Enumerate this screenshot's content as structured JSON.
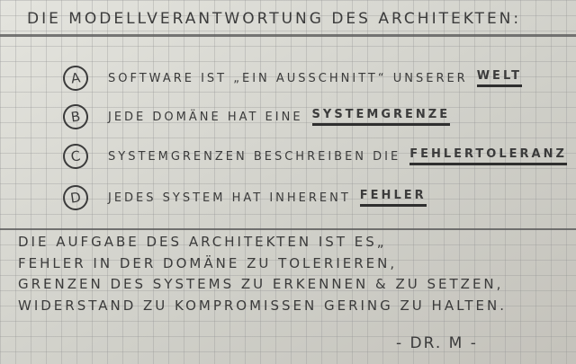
{
  "title": "Die Modellverantwortung des Architekten:",
  "items": [
    {
      "letter": "A",
      "text": "Software ist „ein Ausschnitt“ unserer",
      "key": "Welt"
    },
    {
      "letter": "B",
      "text": "Jede Domäne hat eine",
      "key": "Systemgrenze"
    },
    {
      "letter": "C",
      "text": "Systemgrenzen beschreiben die",
      "key": "Fehlertoleranz"
    },
    {
      "letter": "D",
      "text": "Jedes System hat inherent",
      "key": "Fehler"
    }
  ],
  "paragraph": [
    "Die Aufgabe des Architekten ist es„",
    "Fehler in der Domäne zu tolerieren,",
    "Grenzen des Systems zu erkennen & zu setzen,",
    "Widerstand zu Kompromissen gering zu halten."
  ],
  "signature": "- Dr. M -"
}
